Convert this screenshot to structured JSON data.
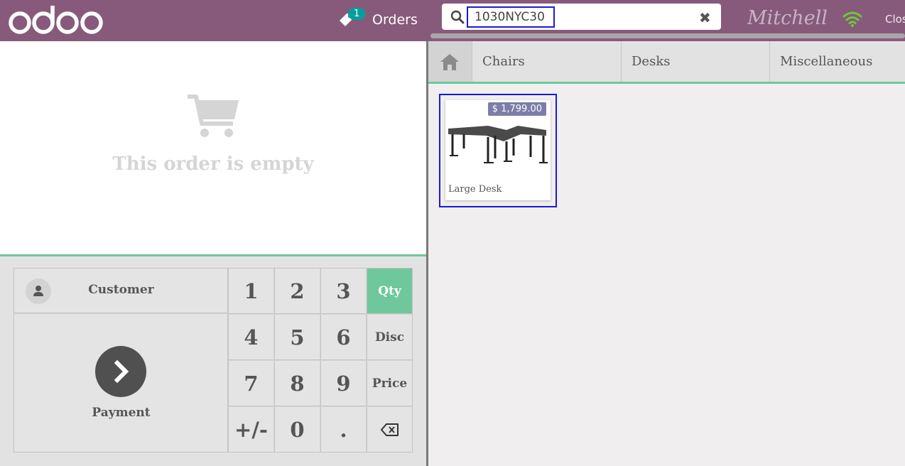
{
  "header": {
    "logo_text": "odoo",
    "orders_count": "1",
    "orders_label": "Orders",
    "search_value": "1030NYC30",
    "cashier_name": "Mitchell",
    "close_label": "Close"
  },
  "order": {
    "empty_text": "This order is empty"
  },
  "pad": {
    "customer_label": "Customer",
    "payment_label": "Payment",
    "keys": {
      "k1": "1",
      "k2": "2",
      "k3": "3",
      "k4": "4",
      "k5": "5",
      "k6": "6",
      "k7": "7",
      "k8": "8",
      "k9": "9",
      "kneg": "+/-",
      "k0": "0",
      "kdot": "."
    },
    "modes": {
      "qty": "Qty",
      "disc": "Disc",
      "price": "Price"
    }
  },
  "categories": [
    "Chairs",
    "Desks",
    "Miscellaneous"
  ],
  "products": [
    {
      "name": "Large Desk",
      "price": "$ 1,799.00"
    }
  ],
  "colors": {
    "header_bg": "#875a7b",
    "accent_green": "#6ec89b",
    "badge_teal": "#00a09d",
    "focus_blue": "#1a1ad6"
  }
}
